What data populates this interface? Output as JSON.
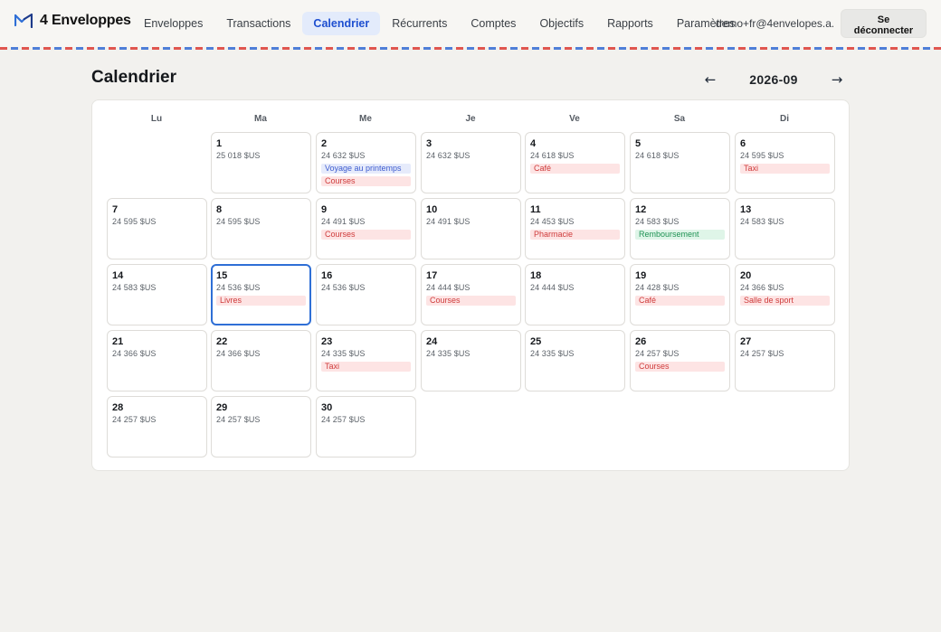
{
  "app": {
    "name": "4 Enveloppes",
    "logo_icon": "envelope-checkmark-logo",
    "accent_color": "#1e4fd0"
  },
  "nav": {
    "items": [
      {
        "label": "Enveloppes",
        "active": false
      },
      {
        "label": "Transactions",
        "active": false
      },
      {
        "label": "Calendrier",
        "active": true
      },
      {
        "label": "Récurrents",
        "active": false
      },
      {
        "label": "Comptes",
        "active": false
      },
      {
        "label": "Objectifs",
        "active": false
      },
      {
        "label": "Rapports",
        "active": false
      },
      {
        "label": "Paramètres",
        "active": false
      }
    ],
    "user_email": "demo+fr@4envelopes.a...",
    "logout_label": "Se déconnecter"
  },
  "page": {
    "title": "Calendrier",
    "month": "2026-09",
    "prev_label": "←",
    "next_label": "→"
  },
  "calendar": {
    "weekdays": [
      "Lu",
      "Ma",
      "Me",
      "Je",
      "Ve",
      "Sa",
      "Di"
    ],
    "first_weekday_offset": 1,
    "today": 15,
    "tag_colors": {
      "red": "#cf3b3b",
      "blue": "#3d5ccf",
      "green": "#1f9254"
    },
    "days": [
      {
        "day": "1",
        "balance": "25 018 $US",
        "tags": []
      },
      {
        "day": "2",
        "balance": "24 632 $US",
        "tags": [
          {
            "label": "Voyage au printemps",
            "color": "blue"
          },
          {
            "label": "Courses",
            "color": "red"
          }
        ]
      },
      {
        "day": "3",
        "balance": "24 632 $US",
        "tags": []
      },
      {
        "day": "4",
        "balance": "24 618 $US",
        "tags": [
          {
            "label": "Café",
            "color": "red"
          }
        ]
      },
      {
        "day": "5",
        "balance": "24 618 $US",
        "tags": []
      },
      {
        "day": "6",
        "balance": "24 595 $US",
        "tags": [
          {
            "label": "Taxi",
            "color": "red"
          }
        ]
      },
      {
        "day": "7",
        "balance": "24 595 $US",
        "tags": []
      },
      {
        "day": "8",
        "balance": "24 595 $US",
        "tags": []
      },
      {
        "day": "9",
        "balance": "24 491 $US",
        "tags": [
          {
            "label": "Courses",
            "color": "red"
          }
        ]
      },
      {
        "day": "10",
        "balance": "24 491 $US",
        "tags": []
      },
      {
        "day": "11",
        "balance": "24 453 $US",
        "tags": [
          {
            "label": "Pharmacie",
            "color": "red"
          }
        ]
      },
      {
        "day": "12",
        "balance": "24 583 $US",
        "tags": [
          {
            "label": "Remboursement",
            "color": "green"
          }
        ]
      },
      {
        "day": "13",
        "balance": "24 583 $US",
        "tags": []
      },
      {
        "day": "14",
        "balance": "24 583 $US",
        "tags": []
      },
      {
        "day": "15",
        "balance": "24 536 $US",
        "tags": [
          {
            "label": "Livres",
            "color": "red"
          }
        ]
      },
      {
        "day": "16",
        "balance": "24 536 $US",
        "tags": []
      },
      {
        "day": "17",
        "balance": "24 444 $US",
        "tags": [
          {
            "label": "Courses",
            "color": "red"
          }
        ]
      },
      {
        "day": "18",
        "balance": "24 444 $US",
        "tags": []
      },
      {
        "day": "19",
        "balance": "24 428 $US",
        "tags": [
          {
            "label": "Café",
            "color": "red"
          }
        ]
      },
      {
        "day": "20",
        "balance": "24 366 $US",
        "tags": [
          {
            "label": "Salle de sport",
            "color": "red"
          }
        ]
      },
      {
        "day": "21",
        "balance": "24 366 $US",
        "tags": []
      },
      {
        "day": "22",
        "balance": "24 366 $US",
        "tags": []
      },
      {
        "day": "23",
        "balance": "24 335 $US",
        "tags": [
          {
            "label": "Taxi",
            "color": "red"
          }
        ]
      },
      {
        "day": "24",
        "balance": "24 335 $US",
        "tags": []
      },
      {
        "day": "25",
        "balance": "24 335 $US",
        "tags": []
      },
      {
        "day": "26",
        "balance": "24 257 $US",
        "tags": [
          {
            "label": "Courses",
            "color": "red"
          }
        ]
      },
      {
        "day": "27",
        "balance": "24 257 $US",
        "tags": []
      },
      {
        "day": "28",
        "balance": "24 257 $US",
        "tags": []
      },
      {
        "day": "29",
        "balance": "24 257 $US",
        "tags": []
      },
      {
        "day": "30",
        "balance": "24 257 $US",
        "tags": []
      }
    ]
  }
}
